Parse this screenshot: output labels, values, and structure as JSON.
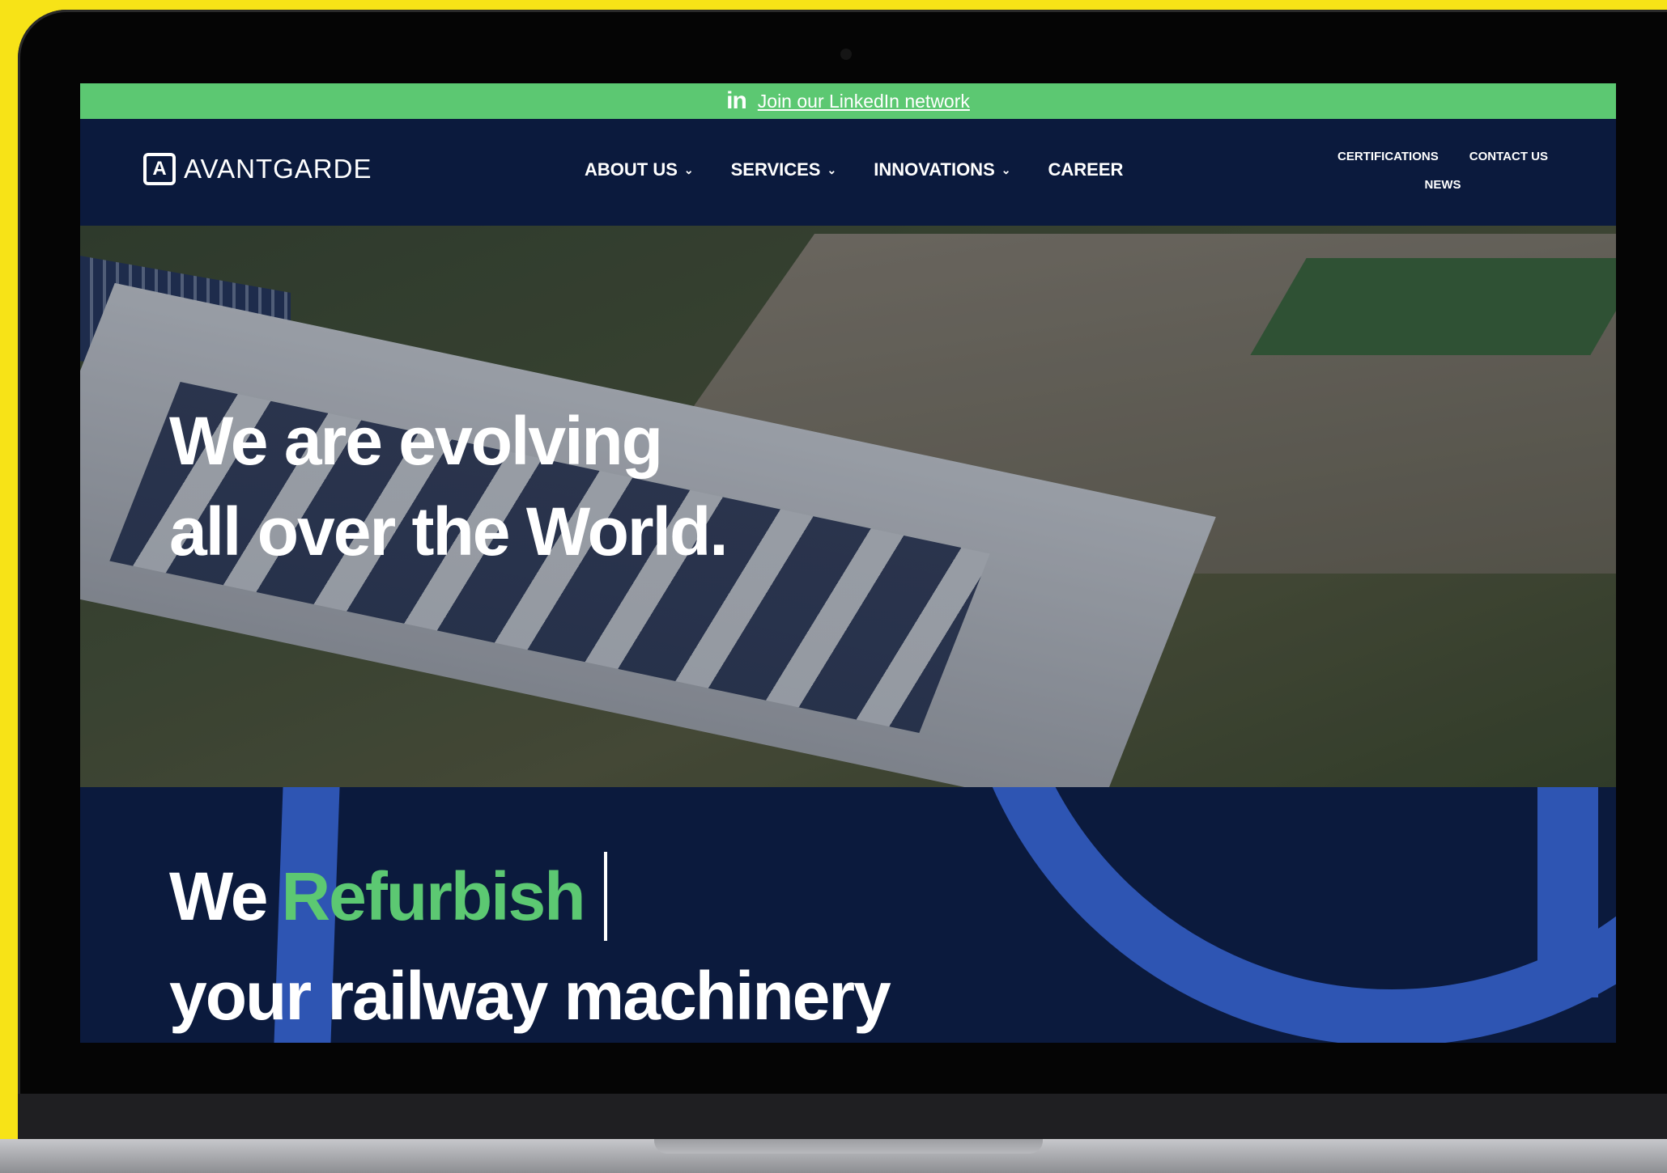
{
  "top_banner": {
    "linkedin_icon": "in",
    "link_text": "Join our LinkedIn network"
  },
  "brand": {
    "logo_mark": "A",
    "name": "AVANTGARDE"
  },
  "nav": {
    "main": [
      {
        "label": "ABOUT US",
        "has_dropdown": true
      },
      {
        "label": "SERVICES",
        "has_dropdown": true
      },
      {
        "label": "INNOVATIONS",
        "has_dropdown": true
      },
      {
        "label": "CAREER",
        "has_dropdown": false
      }
    ],
    "secondary": [
      "CERTIFICATIONS",
      "CONTACT US",
      "NEWS"
    ]
  },
  "hero": {
    "line1": "We are evolving",
    "line2": "all over the World."
  },
  "tagline": {
    "prefix": "We",
    "accent": "Refurbish",
    "line2": "your railway machinery"
  },
  "colors": {
    "accent_green": "#5cc872",
    "navy": "#0b1a3d",
    "blue_arc": "#2e55b3",
    "frame_yellow": "#f7e317"
  }
}
